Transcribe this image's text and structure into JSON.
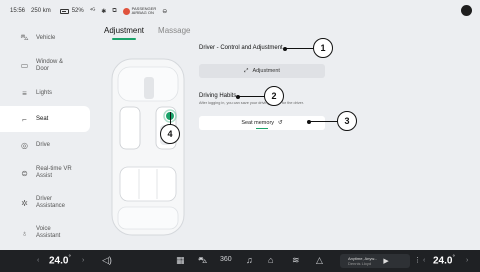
{
  "status": {
    "time": "15:56",
    "range": "250 km",
    "battery_pct": "52%",
    "airbag_line1": "PASSENGER",
    "airbag_line2": "AIRBAG ON"
  },
  "sidebar": {
    "items": [
      {
        "label": "Vehicle",
        "icon": "car-icon"
      },
      {
        "label": "Window & Door",
        "icon": "window-icon"
      },
      {
        "label": "Lights",
        "icon": "lights-icon"
      },
      {
        "label": "Seat",
        "icon": "seat-icon",
        "active": true
      },
      {
        "label": "Drive",
        "icon": "steering-icon"
      },
      {
        "label": "Real-time VR Assist",
        "icon": "vr-icon"
      },
      {
        "label": "Driver Assistance",
        "icon": "assist-icon"
      },
      {
        "label": "Voice Assistant",
        "icon": "voice-icon"
      }
    ]
  },
  "tabs": [
    {
      "label": "Adjustment",
      "active": true
    },
    {
      "label": "Massage",
      "active": false
    }
  ],
  "content": {
    "adjust_title": "Driver - Control and Adjustment",
    "adjust_button": "Adjustment",
    "habits_title": "Driving Habits",
    "habits_desc": "After logging in, you can save your driving habits for the driver.",
    "memory_button": "Seat memory"
  },
  "callouts": [
    "1",
    "2",
    "3",
    "4"
  ],
  "bottom": {
    "left_temp": "24.0",
    "right_temp": "24.0",
    "temp_unit": "°",
    "media_line1": "Anytime, Anyw...",
    "media_line2": "Dennis Lloyd"
  },
  "colors": {
    "accent": "#1ba36a",
    "background": "#eceef1",
    "bottom_bar": "#1f2124"
  }
}
